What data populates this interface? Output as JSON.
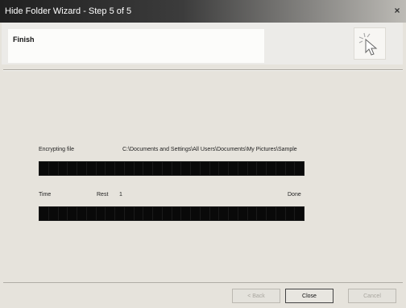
{
  "window": {
    "title": "Hide Folder Wizard - Step 5 of 5",
    "close_glyph": "×"
  },
  "header": {
    "title": "Finish",
    "icon": "cursor-click-icon"
  },
  "content": {
    "encrypting_label": "Encrypting file",
    "encrypting_path": "C:\\Documents and Settings\\All Users\\Documents\\My Pictures\\Sample",
    "progress1_fraction": 1.0,
    "time_label": "Time",
    "time_left_label": "Rest",
    "time_left_value": "1",
    "status_label": "Done",
    "progress2_fraction": 1.0
  },
  "buttons": {
    "back": "< Back",
    "close": "Close",
    "cancel": "Cancel"
  }
}
